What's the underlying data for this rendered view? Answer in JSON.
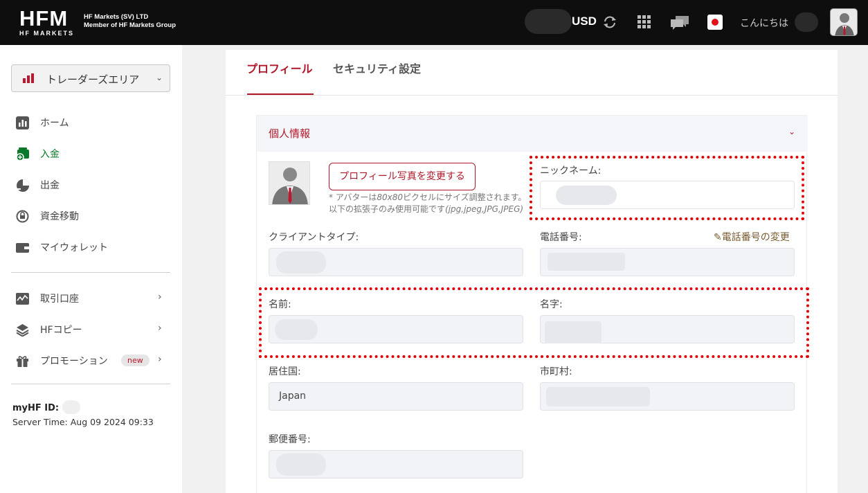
{
  "header": {
    "logo_text": "HFM",
    "logo_sub": "HF MARKETS",
    "company_line1": "HF Markets (SV) LTD",
    "company_line2": "Member of HF Markets Group",
    "currency": "USD",
    "greeting": "こんにちは"
  },
  "sidebar": {
    "area_selector": "トレーダーズエリア",
    "items": [
      {
        "label": "ホーム"
      },
      {
        "label": "入金"
      },
      {
        "label": "出金"
      },
      {
        "label": "資金移動"
      },
      {
        "label": "マイウォレット"
      },
      {
        "label": "取引口座"
      },
      {
        "label": "HFコピー"
      },
      {
        "label": "プロモーション"
      }
    ],
    "new_badge": "new",
    "myhf_label": "myHF ID:",
    "server_time": "Server Time: Aug 09 2024 09:33"
  },
  "tabs": [
    {
      "label": "プロフィール"
    },
    {
      "label": "セキュリティ設定"
    }
  ],
  "section": {
    "title": "個人情報",
    "photo_button": "プロフィール写真を変更する",
    "note_line1_pre": "* アバターは",
    "note_line1_em": "80x80",
    "note_line1_post": "ピクセルにサイズ調整されます。",
    "note_line2_pre": "以下の拡張子のみ使用可能です",
    "note_line2_em": "(jpg,jpeg,JPG,JPEG)",
    "fields": {
      "nickname": {
        "label": "ニックネーム:",
        "value": ""
      },
      "client_type": {
        "label": "クライアントタイプ:",
        "value": ""
      },
      "phone": {
        "label": "電話番号:",
        "value": ""
      },
      "phone_change": "電話番号の変更",
      "first_name": {
        "label": "名前:",
        "value": ""
      },
      "last_name": {
        "label": "名字:",
        "value": ""
      },
      "country": {
        "label": "居住国:",
        "value": "Japan"
      },
      "city": {
        "label": "市町村:",
        "value": ""
      },
      "postal": {
        "label": "郵便番号:",
        "value": ""
      }
    }
  },
  "colors": {
    "brand_red": "#b0182a",
    "active_green": "#0a7a2a",
    "highlight_dots": "#e0000a"
  }
}
